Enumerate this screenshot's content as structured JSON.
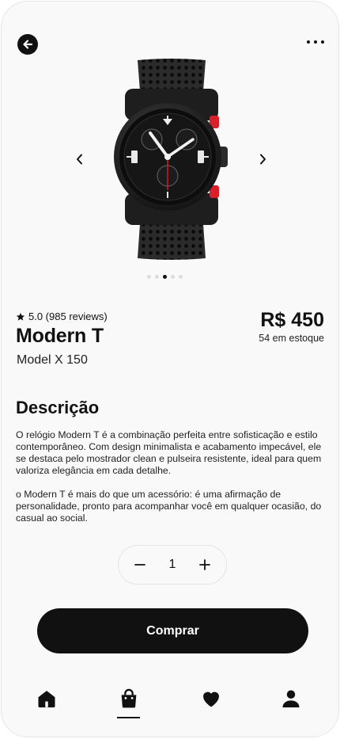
{
  "header": {
    "back_icon": "arrow-left-icon",
    "more_icon": "more-horizontal-icon"
  },
  "carousel": {
    "prev_icon": "chevron-left-icon",
    "next_icon": "chevron-right-icon",
    "image": "black-chronograph-wristwatch",
    "total_slides": 5,
    "active_slide": 3
  },
  "product": {
    "rating_icon": "star-icon",
    "rating": "5.0 (985 reviews)",
    "name": "Modern T",
    "model": "Model X 150",
    "price": "R$ 450",
    "stock": "54 em estoque"
  },
  "description": {
    "title": "Descrição",
    "paragraphs": [
      "O relógio Modern T é a combinação perfeita entre sofisticação e estilo contemporâneo. Com design minimalista e acabamento impecável, ele se destaca pelo mostrador clean e pulseira resistente, ideal para quem valoriza elegância em cada detalhe.",
      "o Modern T é mais do que um acessório: é uma afirmação de personalidade, pronto para acompanhar você em qualquer ocasião, do casual ao social."
    ]
  },
  "quantity": {
    "minus_icon": "minus-icon",
    "value": "1",
    "plus_icon": "plus-icon"
  },
  "buy_button": {
    "label": "Comprar"
  },
  "bottom_nav": {
    "items": [
      {
        "icon": "home-icon"
      },
      {
        "icon": "shopping-bag-icon",
        "active": true
      },
      {
        "icon": "heart-icon"
      },
      {
        "icon": "user-icon"
      }
    ]
  },
  "colors": {
    "primary": "#111111",
    "background": "#f9f9f9",
    "accent_red": "#d8202a"
  }
}
